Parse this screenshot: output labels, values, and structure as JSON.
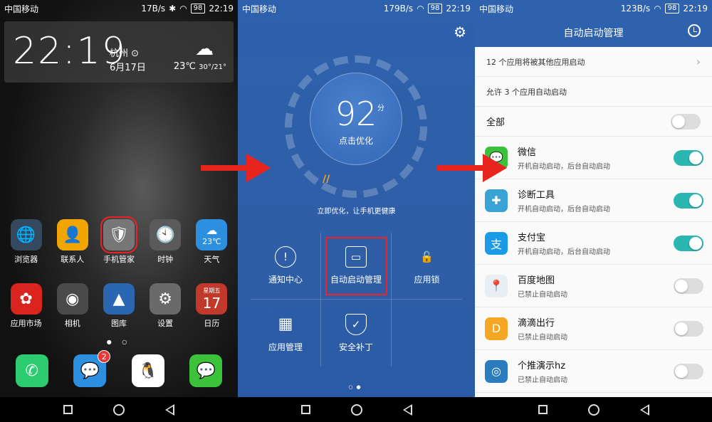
{
  "panel1": {
    "status": {
      "carrier": "中国移动",
      "speed": "17B/s",
      "battery": "98",
      "time": "22:19"
    },
    "clock": {
      "time": "22:19",
      "city": "杭州",
      "date": "6月17日",
      "temp": "23℃",
      "range": "30°/21°"
    },
    "apps_row1": [
      {
        "label": "浏览器",
        "color": "#34495e",
        "icon": "🌐"
      },
      {
        "label": "联系人",
        "color": "#f0a500",
        "icon": "👤"
      },
      {
        "label": "手机管家",
        "color": "#6d6d6d",
        "icon": "🛡"
      },
      {
        "label": "时钟",
        "color": "#5a5a5a",
        "icon": "🕙"
      },
      {
        "label": "天气",
        "color": "#2d8fe0",
        "icon": "☁"
      }
    ],
    "apps_row2": [
      {
        "label": "应用市场",
        "color": "#d9251d",
        "icon": "✿"
      },
      {
        "label": "相机",
        "color": "#4a4a4a",
        "icon": "◉"
      },
      {
        "label": "图库",
        "color": "#2b66b0",
        "icon": "▲"
      },
      {
        "label": "设置",
        "color": "#6a6a6a",
        "icon": "⚙"
      },
      {
        "label": "日历",
        "color": "#c0392b",
        "icon": "17"
      }
    ],
    "weather_icon_text": "23℃",
    "calendar_weekday": "星期五",
    "dock": [
      {
        "label": "电话",
        "color": "#2ecc71",
        "icon": "✆"
      },
      {
        "label": "信息",
        "color": "#2d8fe0",
        "icon": "💬",
        "badge": "2"
      },
      {
        "label": "QQ",
        "color": "#fff",
        "icon": "🐧"
      },
      {
        "label": "微信",
        "color": "#3cc13b",
        "icon": "💬"
      }
    ]
  },
  "panel2": {
    "status": {
      "carrier": "中国移动",
      "speed": "179B/s",
      "battery": "98",
      "time": "22:19"
    },
    "score": "92",
    "score_unit": "分",
    "score_hint": "点击优化",
    "opt_hint": "立即优化，让手机更健康",
    "tiles": [
      {
        "label": "通知中心",
        "icon": "!"
      },
      {
        "label": "自动启动管理",
        "icon": "▭"
      },
      {
        "label": "应用锁",
        "icon": "🔓"
      },
      {
        "label": "应用管理",
        "icon": "▦"
      },
      {
        "label": "安全补丁",
        "icon": "✓"
      }
    ]
  },
  "panel3": {
    "status": {
      "carrier": "中国移动",
      "speed": "123B/s",
      "battery": "98",
      "time": "22:19"
    },
    "title": "自动启动管理",
    "info1": "12 个应用将被其他应用启动",
    "info2": "允许 3 个应用自动启动",
    "all_label": "全部",
    "apps": [
      {
        "name": "微信",
        "sub": "开机自动启动，后台自动启动",
        "color": "#3cc13b",
        "icon": "💬",
        "on": true
      },
      {
        "name": "诊断工具",
        "sub": "开机自动启动，后台自动启动",
        "color": "#3aa3d6",
        "icon": "✚",
        "on": true
      },
      {
        "name": "支付宝",
        "sub": "开机自动启动，后台自动启动",
        "color": "#1a9be6",
        "icon": "支",
        "on": true
      },
      {
        "name": "百度地图",
        "sub": "已禁止自动启动",
        "color": "#e9eef3",
        "icon": "📍",
        "on": false
      },
      {
        "name": "滴滴出行",
        "sub": "已禁止自动启动",
        "color": "#f5a623",
        "icon": "D",
        "on": false
      },
      {
        "name": "个推演示hz",
        "sub": "已禁止自动启动",
        "color": "#2b7cbf",
        "icon": "◎",
        "on": false
      }
    ]
  }
}
